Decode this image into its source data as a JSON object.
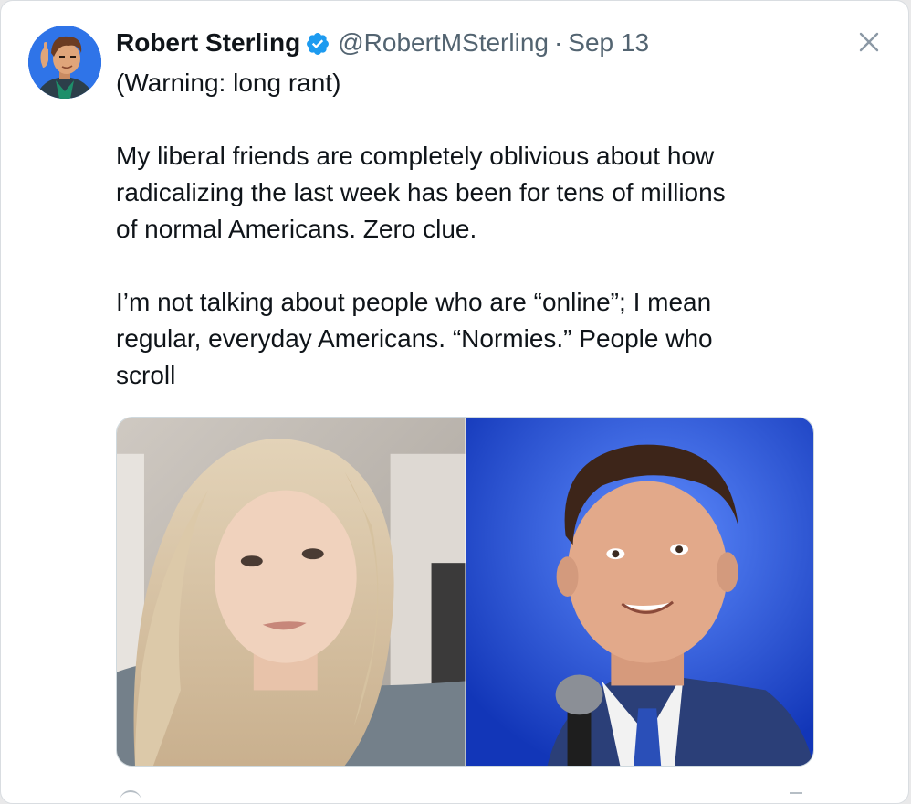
{
  "tweet": {
    "author": {
      "name": "Robert Sterling",
      "handle": "@RobertMSterling",
      "verified": true,
      "avatar_icon": "cartoon-avatar-icon"
    },
    "separator": "·",
    "date": "Sep 13",
    "paragraphs": [
      "(Warning: long rant)",
      "My liberal friends are completely oblivious about how\nradicalizing the last week has been for tens of millions\nof normal Americans. Zero clue.",
      "I’m not talking about people who are “online”; I mean\nregular, everyday Americans. “Normies.” People who\nscroll"
    ],
    "media": [
      {
        "icon": "photo-woman-selfie"
      },
      {
        "icon": "photo-man-speaking-at-microphone"
      }
    ]
  },
  "controls": {
    "close_icon": "close-icon"
  },
  "colors": {
    "verified_badge": "#1d9bf0",
    "secondary_text": "#536471",
    "primary_text": "#0f1419"
  }
}
